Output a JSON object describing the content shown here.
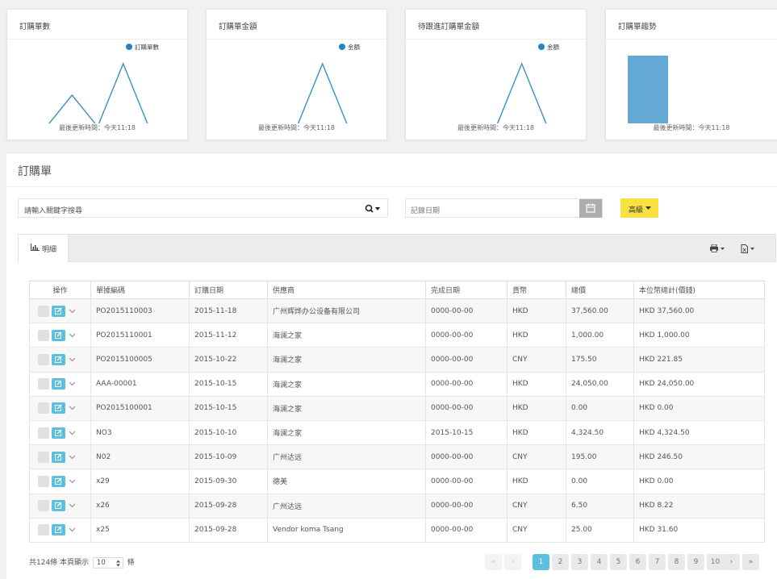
{
  "charts": [
    {
      "title": "訂購單數",
      "legend": "訂購單數",
      "footer": "最後更新時間：今天11:18",
      "legend_color": "#1f87c3"
    },
    {
      "title": "訂購單金額",
      "legend": "金額",
      "footer": "最後更新時間：今天11:18",
      "legend_color": "#1f87c3"
    },
    {
      "title": "待跟進訂購單金額",
      "legend": "金額",
      "footer": "最後更新時間：今天11:18",
      "legend_color": "#1f87c3"
    },
    {
      "title": "訂購單趨勢",
      "legend": "",
      "footer": "最後更新時間：今天11:18"
    }
  ],
  "chart_data": [
    {
      "type": "line",
      "title": "訂購單數",
      "series": [
        {
          "name": "訂購單數",
          "values": [
            0,
            0,
            1,
            0,
            2,
            0,
            0
          ]
        }
      ]
    },
    {
      "type": "line",
      "title": "訂購單金額",
      "series": [
        {
          "name": "金額",
          "values": [
            0,
            0,
            0,
            0,
            1,
            0,
            0
          ]
        }
      ]
    },
    {
      "type": "line",
      "title": "待跟進訂購單金額",
      "series": [
        {
          "name": "金額",
          "values": [
            0,
            0,
            0,
            0,
            1,
            0,
            0
          ]
        }
      ]
    },
    {
      "type": "bar",
      "title": "訂購單趨勢",
      "values": [
        100,
        1,
        1
      ]
    }
  ],
  "panel": {
    "title": "訂購單"
  },
  "search": {
    "placeholder": "請輸入關鍵字搜尋"
  },
  "date_filter": {
    "placeholder": "記錄日期"
  },
  "advanced_button": "高級",
  "tab": {
    "label": "明細"
  },
  "table": {
    "headers": [
      "操作",
      "單據編碼",
      "訂購日期",
      "供應商",
      "完成日期",
      "貨幣",
      "總價",
      "本位幣總計(價錢)"
    ],
    "rows": [
      [
        "PO2015110003",
        "2015-11-18",
        "广州辉烨办公设备有限公司",
        "0000-00-00",
        "HKD",
        "37,560.00",
        "HKD 37,560.00"
      ],
      [
        "PO2015110001",
        "2015-11-12",
        "海澜之家",
        "0000-00-00",
        "HKD",
        "1,000.00",
        "HKD 1,000.00"
      ],
      [
        "PO2015100005",
        "2015-10-22",
        "海澜之家",
        "0000-00-00",
        "CNY",
        "175.50",
        "HKD 221.85"
      ],
      [
        "AAA-00001",
        "2015-10-15",
        "海澜之家",
        "0000-00-00",
        "HKD",
        "24,050.00",
        "HKD 24,050.00"
      ],
      [
        "PO2015100001",
        "2015-10-15",
        "海澜之家",
        "0000-00-00",
        "HKD",
        "0.00",
        "HKD 0.00"
      ],
      [
        "NO3",
        "2015-10-10",
        "海澜之家",
        "2015-10-15",
        "HKD",
        "4,324.50",
        "HKD 4,324.50"
      ],
      [
        "N02",
        "2015-10-09",
        "广州达远",
        "0000-00-00",
        "CNY",
        "195.00",
        "HKD 246.50"
      ],
      [
        "x29",
        "2015-09-30",
        "德美",
        "0000-00-00",
        "HKD",
        "0.00",
        "HKD 0.00"
      ],
      [
        "x26",
        "2015-09-28",
        "广州达远",
        "0000-00-00",
        "CNY",
        "6.50",
        "HKD 8.22"
      ],
      [
        "x25",
        "2015-09-28",
        "Vendor koma Tsang",
        "0000-00-00",
        "CNY",
        "25.00",
        "HKD 31.60"
      ]
    ]
  },
  "footer": {
    "total_text": "共124條 本頁顯示",
    "page_size": "10",
    "unit": "條"
  },
  "pagination": {
    "first": "«",
    "prev": "‹",
    "pages": [
      "1",
      "2",
      "3",
      "4",
      "5",
      "6",
      "7",
      "8",
      "9",
      "10"
    ],
    "current": "1",
    "next": "›",
    "last": "»"
  },
  "icons": [
    "search-icon",
    "calendar-icon",
    "bar-chart-icon",
    "print-icon",
    "export-icon",
    "edit-icon",
    "chevron-down-icon"
  ]
}
